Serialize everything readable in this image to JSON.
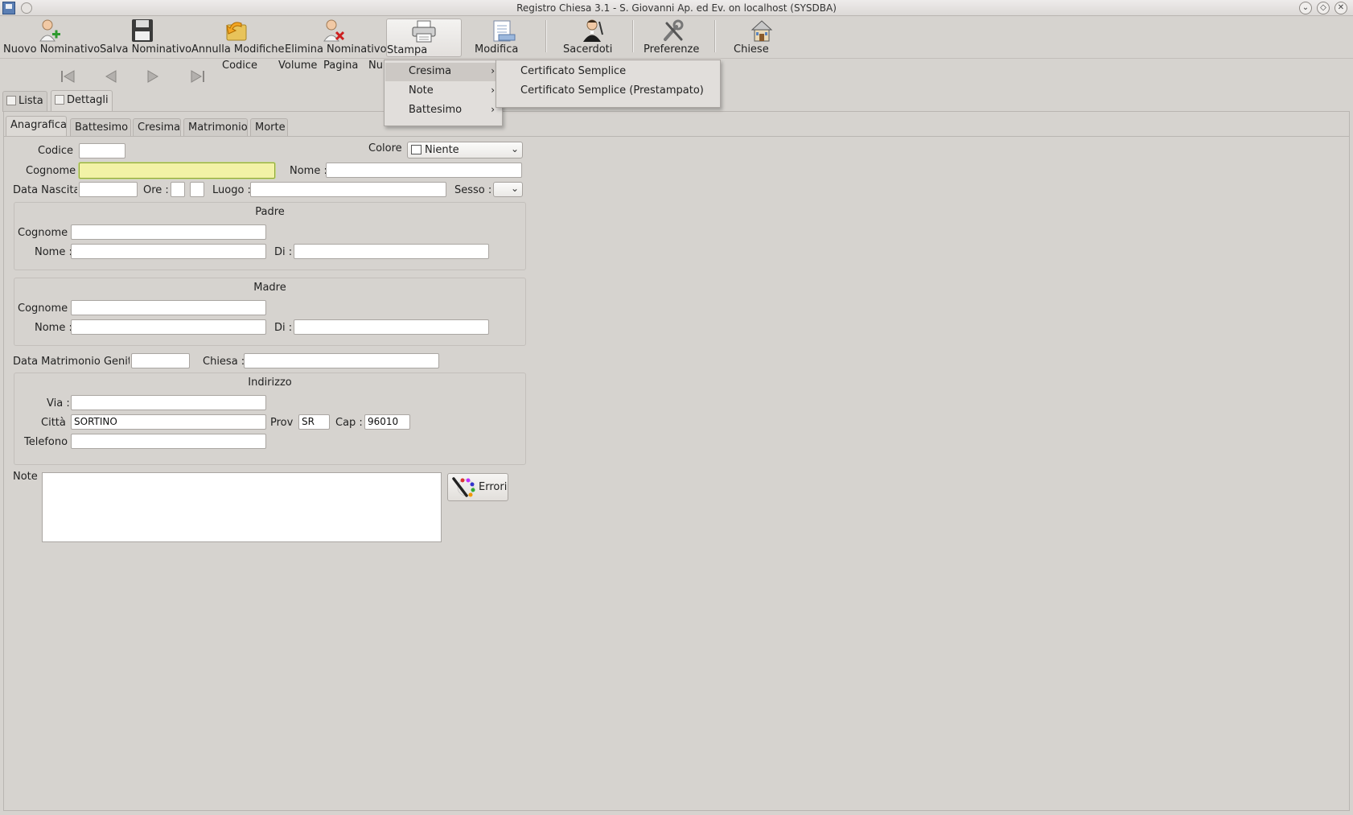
{
  "window": {
    "title": "Registro Chiesa 3.1 - S. Giovanni Ap. ed Ev. on localhost (SYSDBA)"
  },
  "toolbar": {
    "buttons": [
      {
        "label": "Nuovo Nominativo",
        "icon": "add-person-icon"
      },
      {
        "label": "Salva Nominativo",
        "icon": "floppy-disk-icon"
      },
      {
        "label": "Annulla Modifiche",
        "icon": "undo-folder-icon"
      },
      {
        "label": "Elimina Nominativo",
        "icon": "remove-person-icon"
      },
      {
        "label": "Stampa",
        "icon": "printer-icon"
      },
      {
        "label": "Modifica",
        "icon": "edit-document-icon"
      },
      {
        "label": "Sacerdoti",
        "icon": "priest-icon"
      },
      {
        "label": "Preferenze",
        "icon": "tools-icon"
      },
      {
        "label": "Chiese",
        "icon": "church-icon"
      }
    ]
  },
  "nav": {
    "labels": [
      "Codice",
      "Volume",
      "Pagina",
      "Nu"
    ]
  },
  "tabs": [
    {
      "label": "Lista"
    },
    {
      "label": "Dettagli"
    }
  ],
  "subtabs": [
    {
      "label": "Anagrafica"
    },
    {
      "label": "Battesimo"
    },
    {
      "label": "Cresima"
    },
    {
      "label": "Matrimonio"
    },
    {
      "label": "Morte"
    }
  ],
  "form": {
    "codice_label": "Codice",
    "codice_value": "",
    "colore_label": "Colore",
    "colore_value": "Niente",
    "cognome_label": "Cognome",
    "cognome_value": "",
    "nome_label": "Nome :",
    "nome_value": "",
    "data_nascita_label": "Data Nascita",
    "ore_label": "Ore :",
    "luogo_label": "Luogo :",
    "sesso_label": "Sesso :",
    "padre": {
      "title": "Padre",
      "cognome_label": "Cognome",
      "nome_label": "Nome :",
      "di_label": "Di :"
    },
    "madre": {
      "title": "Madre",
      "cognome_label": "Cognome",
      "nome_label": "Nome :",
      "di_label": "Di :"
    },
    "data_matrimonio_label": "Data Matrimonio Genito",
    "chiesa_label": "Chiesa :",
    "indirizzo": {
      "title": "Indirizzo",
      "via_label": "Via :",
      "citta_label": "Città",
      "citta_value": "SORTINO",
      "prov_label": "Prov",
      "prov_value": "SR",
      "cap_label": "Cap :",
      "cap_value": "96010",
      "telefono_label": "Telefono"
    },
    "note_label": "Note :",
    "errori_label": "Errori"
  },
  "stampa_menu": {
    "items": [
      {
        "label": "Cresima",
        "has_submenu": true,
        "highlighted": true
      },
      {
        "label": "Note",
        "has_submenu": true
      },
      {
        "label": "Battesimo",
        "has_submenu": true
      }
    ],
    "submenu": [
      {
        "label": "Certificato Semplice"
      },
      {
        "label": "Certificato Semplice (Prestampato)"
      }
    ]
  }
}
